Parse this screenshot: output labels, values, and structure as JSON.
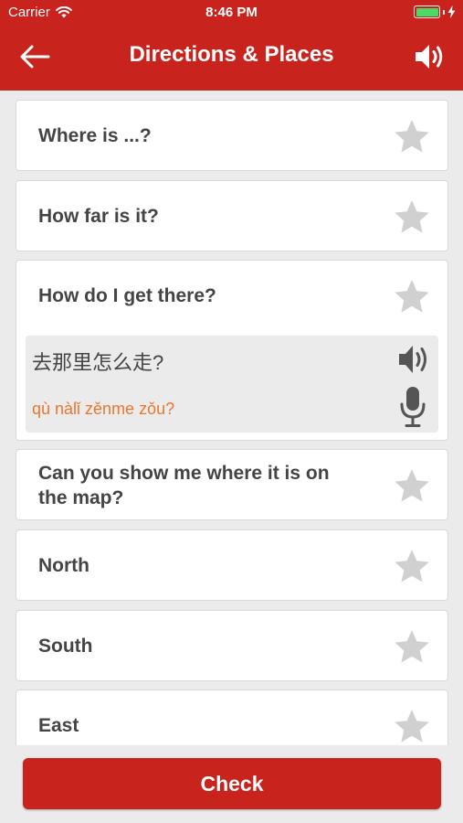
{
  "status_bar": {
    "carrier": "Carrier",
    "time": "8:46 PM",
    "battery_level": 1.0
  },
  "header": {
    "title": "Directions & Places",
    "back_icon": "back-arrow-icon",
    "speaker_icon": "speaker-icon"
  },
  "phrases": [
    {
      "english": "Where is ...?",
      "starred": false
    },
    {
      "english": "How far is it?",
      "starred": false
    },
    {
      "english": "How do I get there?",
      "starred": false,
      "expanded": true,
      "chinese": "去那里怎么走?",
      "pinyin": "qù nàlǐ zěnme zǒu?"
    },
    {
      "english": "Can you show me where it is on the map?",
      "starred": false
    },
    {
      "english": "North",
      "starred": false
    },
    {
      "english": "South",
      "starred": false
    },
    {
      "english": "East",
      "starred": false
    }
  ],
  "footer": {
    "check_label": "Check"
  },
  "colors": {
    "brand_red": "#c8231c",
    "pinyin_orange": "#e8772e",
    "star_gray": "#d0d0d0",
    "text_dark": "#444444",
    "background": "#ebebeb"
  }
}
